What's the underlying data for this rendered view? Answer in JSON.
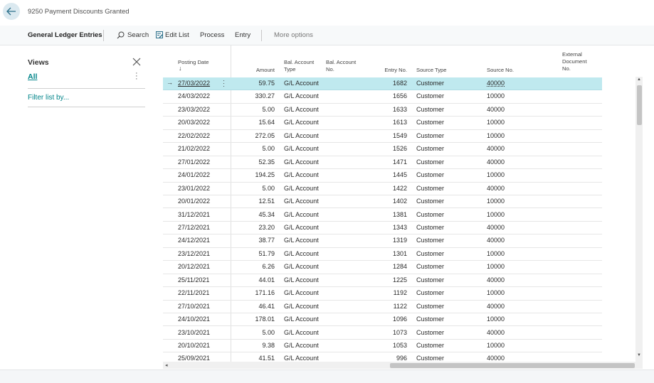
{
  "page": {
    "title": "9250 Payment Discounts Granted"
  },
  "actionbar": {
    "title": "General Ledger Entries",
    "search": "Search",
    "edit_list": "Edit List",
    "process": "Process",
    "entry": "Entry",
    "more_options": "More options",
    "icons": {
      "search": "search-icon",
      "edit_list": "edit-list-icon"
    }
  },
  "views": {
    "title": "Views",
    "all": "All",
    "filter": "Filter list by..."
  },
  "table": {
    "headers": {
      "posting_date": "Posting Date",
      "sort_arrow": "↓",
      "amount": "Amount",
      "bal_type_1": "Bal. Account",
      "bal_type_2": "Type",
      "bal_no_1": "Bal. Account",
      "bal_no_2": "No.",
      "entry_no": "Entry No.",
      "source_type": "Source Type",
      "source_no": "Source No.",
      "ext_1": "External",
      "ext_2": "Document",
      "ext_3": "No."
    },
    "rows": [
      {
        "date": "27/03/2022",
        "amount": "59.75",
        "bal_type": "G/L Account",
        "entry": "1682",
        "src_type": "Customer",
        "src_no": "40000"
      },
      {
        "date": "24/03/2022",
        "amount": "330.27",
        "bal_type": "G/L Account",
        "entry": "1656",
        "src_type": "Customer",
        "src_no": "10000"
      },
      {
        "date": "23/03/2022",
        "amount": "5.00",
        "bal_type": "G/L Account",
        "entry": "1633",
        "src_type": "Customer",
        "src_no": "40000"
      },
      {
        "date": "20/03/2022",
        "amount": "15.64",
        "bal_type": "G/L Account",
        "entry": "1613",
        "src_type": "Customer",
        "src_no": "10000"
      },
      {
        "date": "22/02/2022",
        "amount": "272.05",
        "bal_type": "G/L Account",
        "entry": "1549",
        "src_type": "Customer",
        "src_no": "10000"
      },
      {
        "date": "21/02/2022",
        "amount": "5.00",
        "bal_type": "G/L Account",
        "entry": "1526",
        "src_type": "Customer",
        "src_no": "40000"
      },
      {
        "date": "27/01/2022",
        "amount": "52.35",
        "bal_type": "G/L Account",
        "entry": "1471",
        "src_type": "Customer",
        "src_no": "40000"
      },
      {
        "date": "24/01/2022",
        "amount": "194.25",
        "bal_type": "G/L Account",
        "entry": "1445",
        "src_type": "Customer",
        "src_no": "10000"
      },
      {
        "date": "23/01/2022",
        "amount": "5.00",
        "bal_type": "G/L Account",
        "entry": "1422",
        "src_type": "Customer",
        "src_no": "40000"
      },
      {
        "date": "20/01/2022",
        "amount": "12.51",
        "bal_type": "G/L Account",
        "entry": "1402",
        "src_type": "Customer",
        "src_no": "10000"
      },
      {
        "date": "31/12/2021",
        "amount": "45.34",
        "bal_type": "G/L Account",
        "entry": "1381",
        "src_type": "Customer",
        "src_no": "10000"
      },
      {
        "date": "27/12/2021",
        "amount": "23.20",
        "bal_type": "G/L Account",
        "entry": "1343",
        "src_type": "Customer",
        "src_no": "40000"
      },
      {
        "date": "24/12/2021",
        "amount": "38.77",
        "bal_type": "G/L Account",
        "entry": "1319",
        "src_type": "Customer",
        "src_no": "40000"
      },
      {
        "date": "23/12/2021",
        "amount": "51.79",
        "bal_type": "G/L Account",
        "entry": "1301",
        "src_type": "Customer",
        "src_no": "10000"
      },
      {
        "date": "20/12/2021",
        "amount": "6.26",
        "bal_type": "G/L Account",
        "entry": "1284",
        "src_type": "Customer",
        "src_no": "10000"
      },
      {
        "date": "25/11/2021",
        "amount": "44.01",
        "bal_type": "G/L Account",
        "entry": "1225",
        "src_type": "Customer",
        "src_no": "40000"
      },
      {
        "date": "22/11/2021",
        "amount": "171.16",
        "bal_type": "G/L Account",
        "entry": "1192",
        "src_type": "Customer",
        "src_no": "10000"
      },
      {
        "date": "27/10/2021",
        "amount": "46.41",
        "bal_type": "G/L Account",
        "entry": "1122",
        "src_type": "Customer",
        "src_no": "40000"
      },
      {
        "date": "24/10/2021",
        "amount": "178.01",
        "bal_type": "G/L Account",
        "entry": "1096",
        "src_type": "Customer",
        "src_no": "10000"
      },
      {
        "date": "23/10/2021",
        "amount": "5.00",
        "bal_type": "G/L Account",
        "entry": "1073",
        "src_type": "Customer",
        "src_no": "40000"
      },
      {
        "date": "20/10/2021",
        "amount": "9.38",
        "bal_type": "G/L Account",
        "entry": "1053",
        "src_type": "Customer",
        "src_no": "10000"
      },
      {
        "date": "25/09/2021",
        "amount": "41.51",
        "bal_type": "G/L Account",
        "entry": "996",
        "src_type": "Customer",
        "src_no": "40000"
      }
    ]
  },
  "colors": {
    "accent": "#008489",
    "selected_row": "#bfe9ef"
  }
}
